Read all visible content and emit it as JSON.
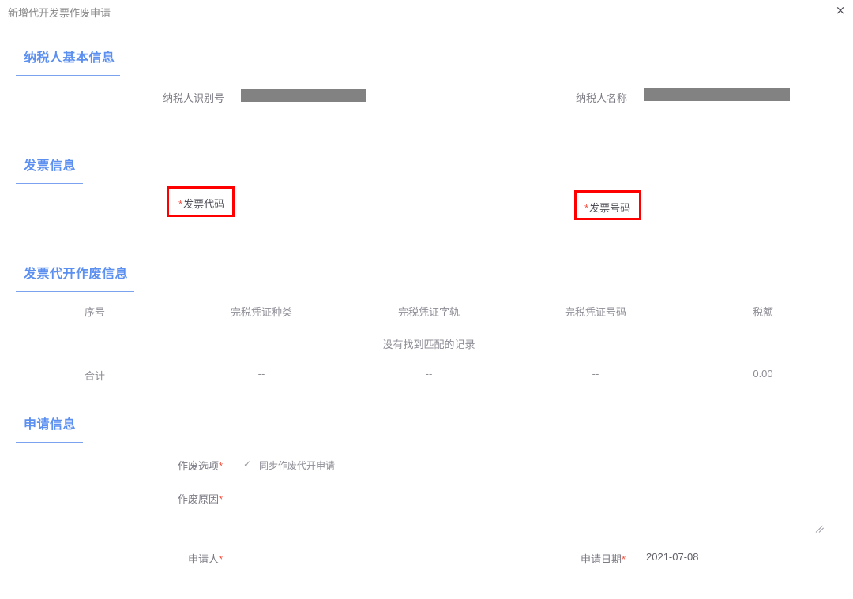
{
  "window": {
    "title": "新增代开发票作废申请",
    "close_label": "×"
  },
  "sections": {
    "taxpayer": {
      "title": "纳税人基本信息",
      "fields": {
        "taxpayer_id_label": "纳税人识别号",
        "taxpayer_id_value": "",
        "taxpayer_name_label": "纳税人名称",
        "taxpayer_name_value": ""
      }
    },
    "invoice": {
      "title": "发票信息",
      "fields": {
        "invoice_code_label": "发票代码",
        "invoice_code_required": "*",
        "invoice_number_label": "发票号码",
        "invoice_number_required": "*"
      }
    },
    "void_info": {
      "title": "发票代开作废信息",
      "table": {
        "headers": [
          "序号",
          "完税凭证种类",
          "完税凭证字轨",
          "完税凭证号码",
          "税额"
        ],
        "empty_message": "没有找到匹配的记录",
        "total_row": [
          "合计",
          "--",
          "--",
          "--",
          "0.00"
        ]
      }
    },
    "application": {
      "title": "申请信息",
      "fields": {
        "void_option_label": "作废选项",
        "void_option_required": "*",
        "void_option_checkbox_glyph": "✓",
        "void_option_checkbox_text": "同步作废代开申请",
        "void_reason_label": "作废原因",
        "void_reason_required": "*",
        "void_reason_value": "",
        "applicant_label": "申请人",
        "applicant_required": "*",
        "applicant_value": "",
        "apply_date_label": "申请日期",
        "apply_date_required": "*",
        "apply_date_value": "2021-07-08"
      }
    }
  },
  "colors": {
    "accent_blue": "#5b8ff0",
    "required_red": "#f5503f",
    "annotation_red": "#fe0000",
    "redacted_gray": "#828282",
    "label_gray": "#7b7b84"
  }
}
